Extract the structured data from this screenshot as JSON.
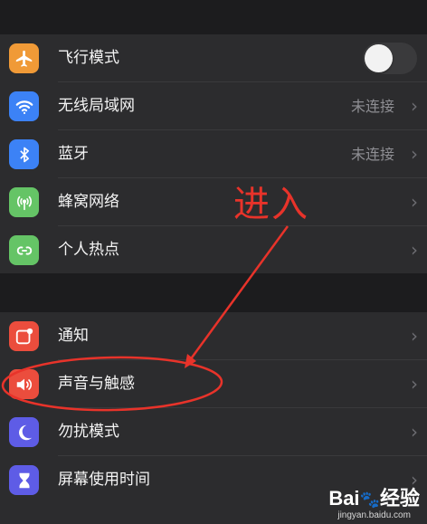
{
  "colors": {
    "background": "#1c1c1e",
    "cell": "#2c2c2e",
    "annotation_red": "#e8332a"
  },
  "group1": {
    "rows": [
      {
        "label": "飞行模式",
        "icon": "airplane-icon",
        "icon_color": "#f09a37",
        "control": "toggle",
        "toggle_on": false
      },
      {
        "label": "无线局域网",
        "icon": "wifi-icon",
        "icon_color": "#3c82f6",
        "value": "未连接"
      },
      {
        "label": "蓝牙",
        "icon": "bluetooth-icon",
        "icon_color": "#3c82f6",
        "value": "未连接"
      },
      {
        "label": "蜂窝网络",
        "icon": "cellular-icon",
        "icon_color": "#65c466"
      },
      {
        "label": "个人热点",
        "icon": "hotspot-icon",
        "icon_color": "#65c466"
      }
    ]
  },
  "group2": {
    "rows": [
      {
        "label": "通知",
        "icon": "notifications-icon",
        "icon_color": "#eb4d3d"
      },
      {
        "label": "声音与触感",
        "icon": "sound-icon",
        "icon_color": "#eb4d3d"
      },
      {
        "label": "勿扰模式",
        "icon": "moon-icon",
        "icon_color": "#5e5ce6"
      },
      {
        "label": "屏幕使用时间",
        "icon": "hourglass-icon",
        "icon_color": "#5e5ce6"
      }
    ]
  },
  "chevron": "›",
  "annotation": {
    "text": "进入"
  },
  "watermark": {
    "brand_a": "Bai",
    "brand_paw": "🐾",
    "brand_b": "经验",
    "url": "jingyan.baidu.com"
  }
}
